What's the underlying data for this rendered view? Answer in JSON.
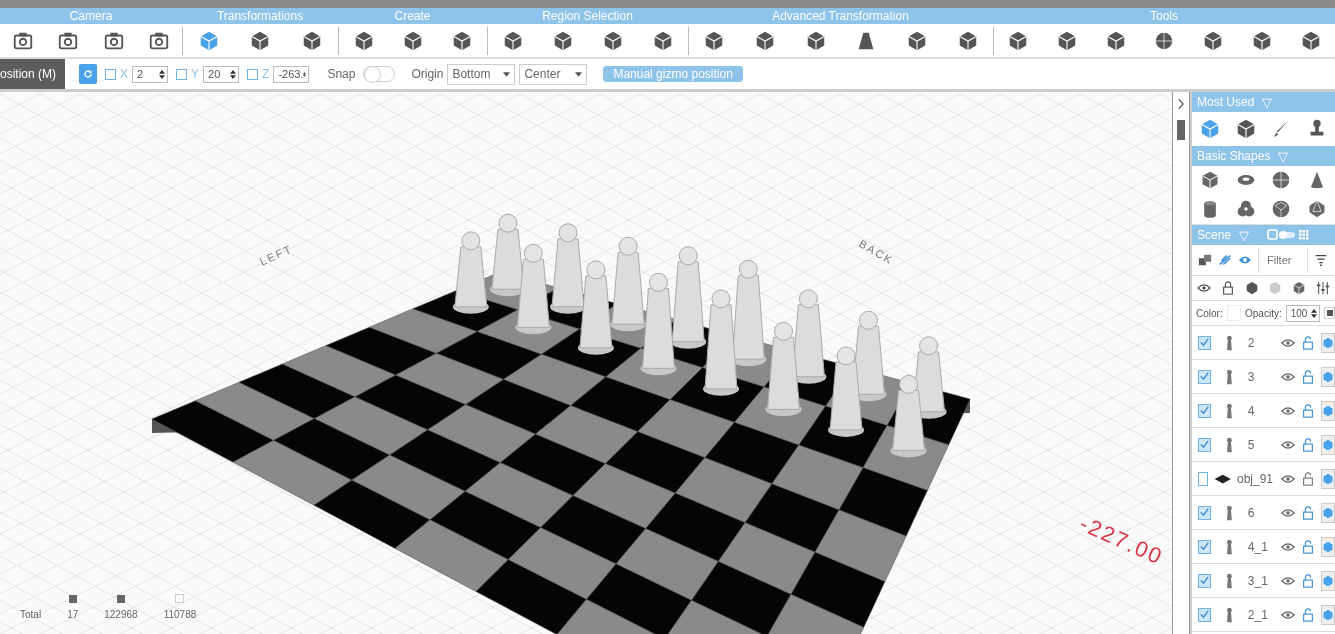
{
  "toolbar": {
    "groups": [
      {
        "label": "Camera",
        "tools": [
          {
            "selected": false
          },
          {
            "selected": false
          },
          {
            "selected": false
          },
          {
            "selected": false
          }
        ]
      },
      {
        "label": "Transformations",
        "tools": [
          {
            "selected": true
          },
          {
            "selected": false
          },
          {
            "selected": false
          }
        ]
      },
      {
        "label": "Create",
        "tools": [
          {
            "selected": false
          },
          {
            "selected": false
          },
          {
            "selected": false
          }
        ]
      },
      {
        "label": "Region Selection",
        "tools": [
          {
            "selected": false
          },
          {
            "selected": false
          },
          {
            "selected": false
          },
          {
            "selected": false
          }
        ]
      },
      {
        "label": "Advanced Transformation",
        "tools": [
          {
            "selected": false
          },
          {
            "selected": false
          },
          {
            "selected": false
          },
          {
            "selected": false
          },
          {
            "selected": false
          },
          {
            "selected": false
          }
        ]
      },
      {
        "label": "Tools",
        "tools": [
          {
            "selected": false
          },
          {
            "selected": false
          },
          {
            "selected": false
          },
          {
            "selected": false
          },
          {
            "selected": false
          },
          {
            "selected": false
          },
          {
            "selected": false
          }
        ]
      }
    ]
  },
  "options": {
    "mode_tab": "osition (M)",
    "axes": [
      {
        "label": "X",
        "checked": false,
        "value": "2"
      },
      {
        "label": "Y",
        "checked": false,
        "value": "20"
      },
      {
        "label": "Z",
        "checked": false,
        "value": "-263."
      }
    ],
    "snap": {
      "label": "Snap",
      "on": false
    },
    "origin": {
      "label": "Origin",
      "values": [
        "Bottom",
        "Center"
      ]
    },
    "gizmo_button": "Manual gizmo position"
  },
  "viewport": {
    "axis_labels": [
      "LEFT",
      "BACK"
    ],
    "measurement": "-227.00",
    "stats": [
      {
        "label": "Total"
      },
      {
        "label": "17",
        "kind": "filled"
      },
      {
        "label": "122968",
        "kind": "filled"
      },
      {
        "label": "110788",
        "kind": "outline"
      }
    ]
  },
  "panel": {
    "most_used": {
      "title": "Most Used",
      "toggle": "▽",
      "tools": [
        {
          "selected": true
        },
        {
          "selected": false
        },
        {
          "selected": false
        },
        {
          "selected": false
        }
      ]
    },
    "basic_shapes": {
      "title": "Basic Shapes",
      "toggle": "▽"
    },
    "scene": {
      "title": "Scene",
      "toggle": "▽",
      "filter_placeholder": "Filter",
      "color_label": "Color:",
      "opacity_label": "Opacity:",
      "opacity": "100",
      "objects": [
        {
          "name": "2",
          "checked": true,
          "kind": "piece"
        },
        {
          "name": "3",
          "checked": true,
          "kind": "piece"
        },
        {
          "name": "4",
          "checked": true,
          "kind": "piece"
        },
        {
          "name": "5",
          "checked": true,
          "kind": "piece"
        },
        {
          "name": "obj_91",
          "checked": false,
          "kind": "mesh"
        },
        {
          "name": "6",
          "checked": true,
          "kind": "piece"
        },
        {
          "name": "4_1",
          "checked": true,
          "kind": "piece"
        },
        {
          "name": "3_1",
          "checked": true,
          "kind": "piece"
        },
        {
          "name": "2_1",
          "checked": true,
          "kind": "piece"
        }
      ]
    }
  }
}
